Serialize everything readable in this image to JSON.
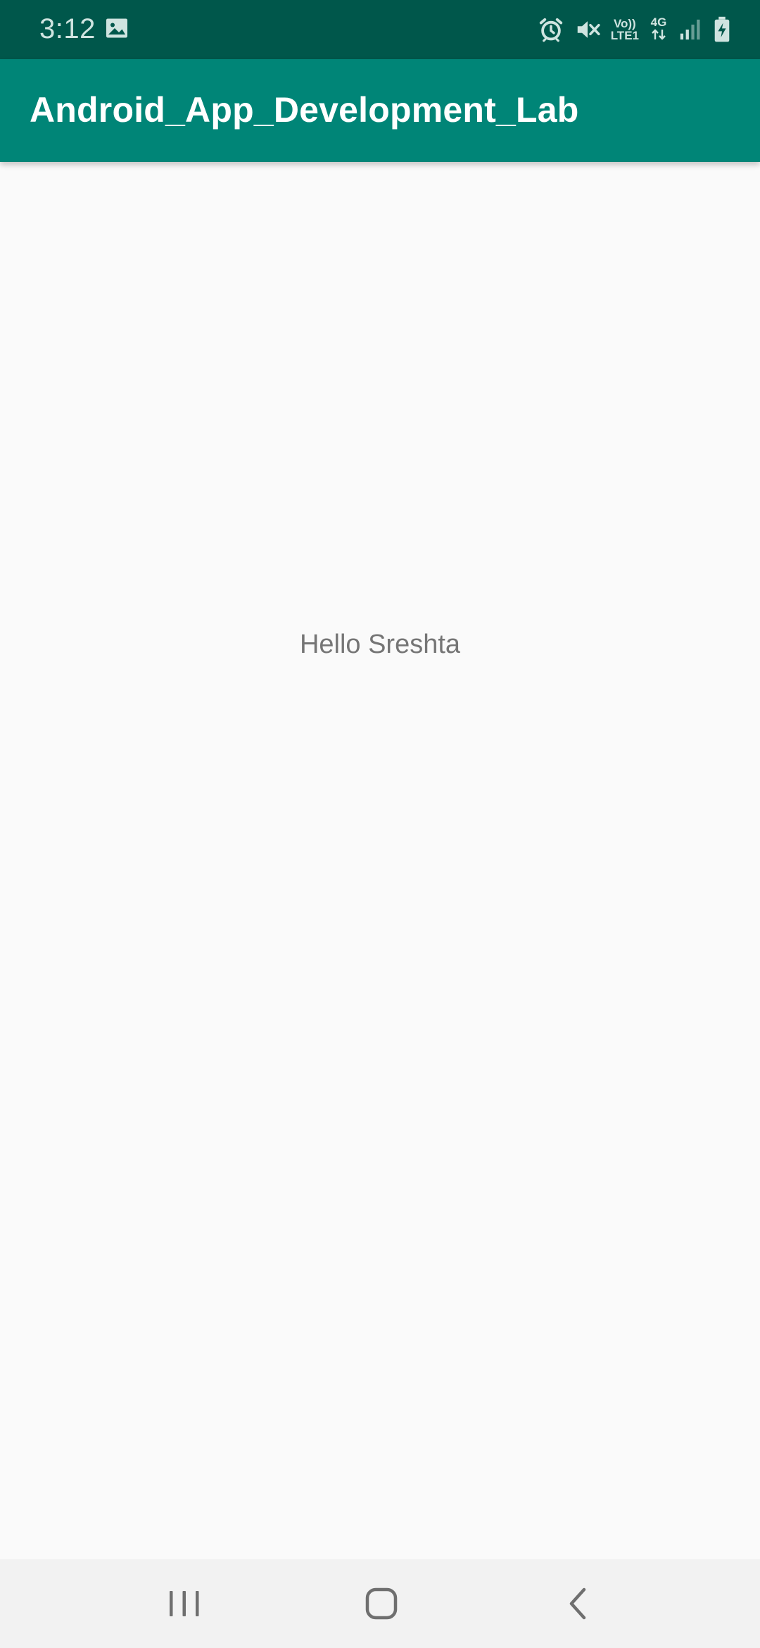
{
  "status_bar": {
    "time": "3:12",
    "icons": [
      "gallery-icon",
      "alarm-icon",
      "mute-icon",
      "volte-icon",
      "network-4g-icon",
      "signal-icon",
      "battery-charging-icon"
    ],
    "volte_line1": "Vo))",
    "volte_line2": "LTE1",
    "network_type": "4G"
  },
  "app_bar": {
    "title": "Android_App_Development_Lab",
    "color": "#008577",
    "status_color": "#00574b"
  },
  "content": {
    "message": "Hello Sreshta"
  },
  "nav_bar": {
    "buttons": [
      "recent-apps",
      "home",
      "back"
    ]
  }
}
